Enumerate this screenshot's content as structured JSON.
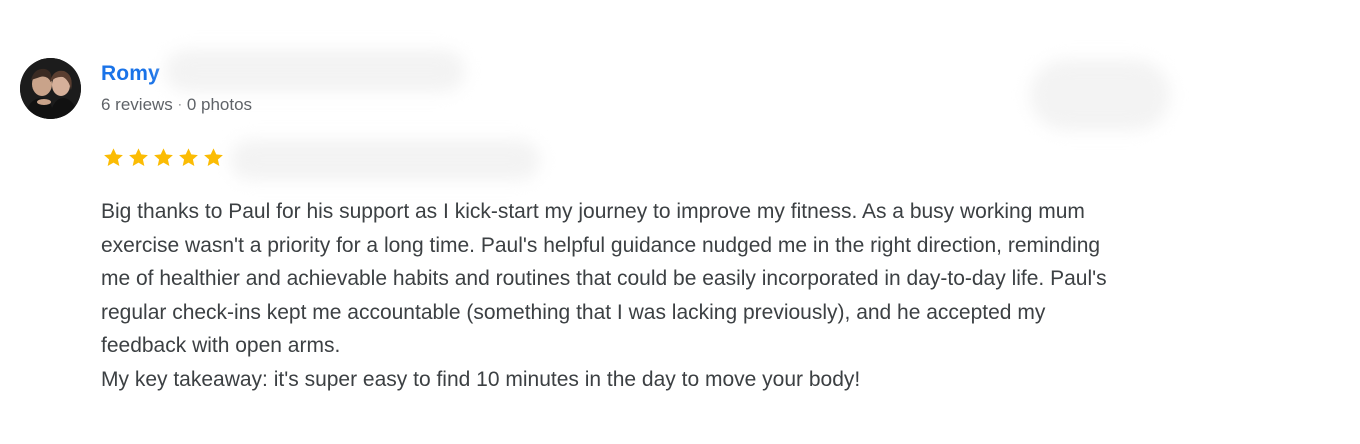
{
  "author": {
    "name": "Romy",
    "reviews": "6 reviews",
    "separator": "·",
    "photos": "0 photos",
    "avatar_icon": "user-avatar-photo"
  },
  "rating": {
    "value": 5,
    "max": 5,
    "star_color": "#fbbc04"
  },
  "review": {
    "paragraph1": "Big thanks to Paul for his support as I kick-start my journey to improve my fitness. As a busy working mum exercise wasn't a priority for a long time. Paul's helpful guidance nudged me in the right direction, reminding me of healthier and achievable habits and routines that could be easily incorporated in day-to-day life. Paul's regular check-ins kept me accountable (something that I was lacking previously), and he accepted my feedback with open arms.",
    "paragraph2": "My key takeaway: it's super easy to find 10 minutes in the day to move your body!"
  },
  "colors": {
    "name_link": "#1a73e8",
    "meta_text": "#5f6368",
    "body_text": "#3c4043"
  }
}
